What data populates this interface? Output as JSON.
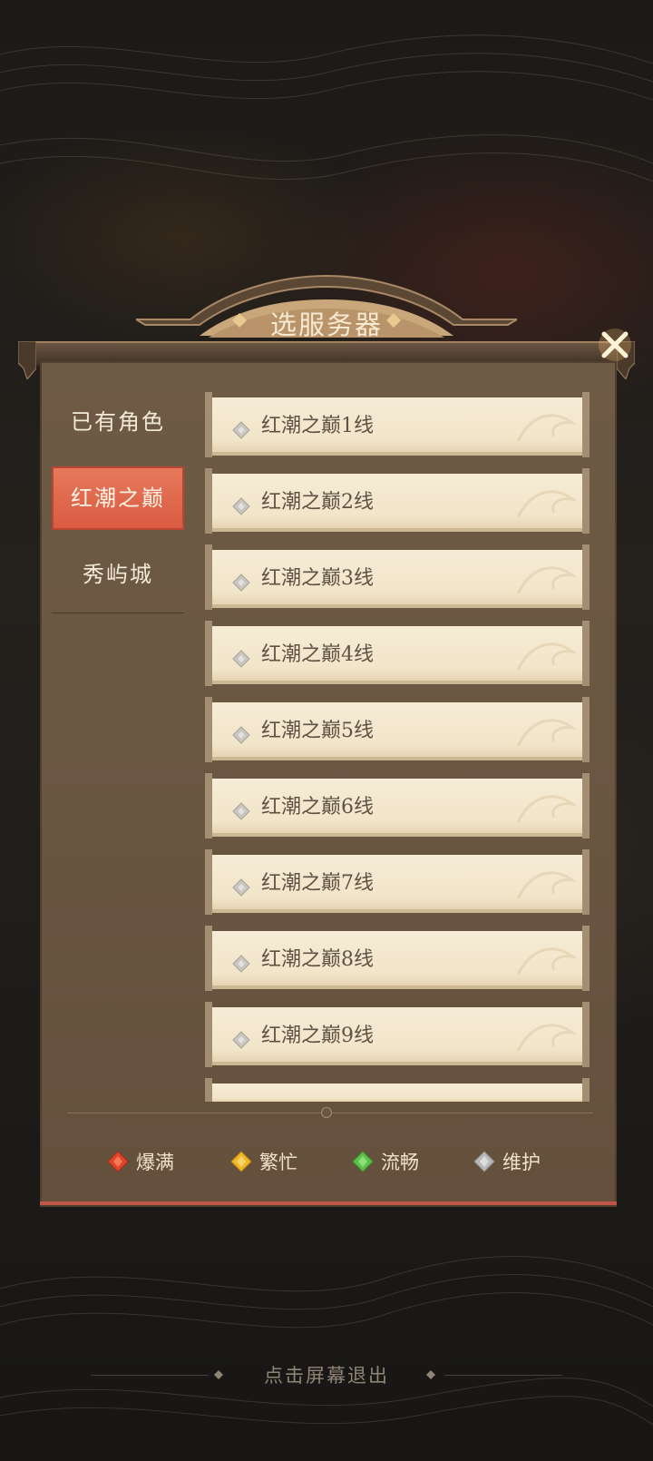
{
  "dialog": {
    "title": "选服务器",
    "close_icon": "close-x-icon"
  },
  "sidebar": {
    "items": [
      {
        "label": "已有角色",
        "active": false
      },
      {
        "label": "红潮之巅",
        "active": true
      },
      {
        "label": "秀屿城",
        "active": false
      }
    ]
  },
  "servers": [
    {
      "label": "红潮之巅1线",
      "status": "maintenance"
    },
    {
      "label": "红潮之巅2线",
      "status": "maintenance"
    },
    {
      "label": "红潮之巅3线",
      "status": "maintenance"
    },
    {
      "label": "红潮之巅4线",
      "status": "maintenance"
    },
    {
      "label": "红潮之巅5线",
      "status": "maintenance"
    },
    {
      "label": "红潮之巅6线",
      "status": "maintenance"
    },
    {
      "label": "红潮之巅7线",
      "status": "maintenance"
    },
    {
      "label": "红潮之巅8线",
      "status": "maintenance"
    },
    {
      "label": "红潮之巅9线",
      "status": "maintenance"
    }
  ],
  "legend": [
    {
      "label": "爆满",
      "color": "#e0452a"
    },
    {
      "label": "繁忙",
      "color": "#f0b72a"
    },
    {
      "label": "流畅",
      "color": "#5fc24a"
    },
    {
      "label": "维护",
      "color": "#b8b8b8"
    }
  ],
  "footer": {
    "exit_tip": "点击屏幕退出"
  },
  "colors": {
    "active_tab": "#d95a41",
    "card": "#f3e8cf",
    "panel": "#6b5843"
  }
}
